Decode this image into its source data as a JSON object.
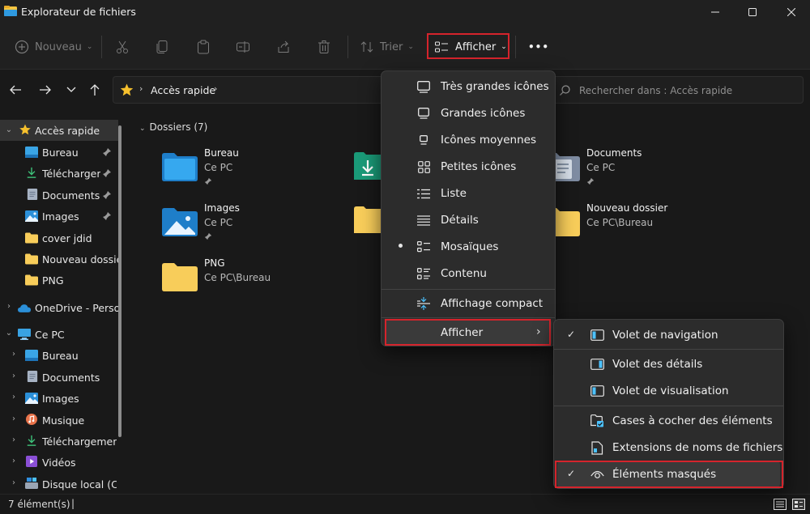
{
  "window": {
    "title": "Explorateur de fichiers"
  },
  "toolbar": {
    "new_label": "Nouveau",
    "sort_label": "Trier",
    "view_label": "Afficher",
    "more_label": "•••"
  },
  "address": {
    "breadcrumb": "Accès rapide",
    "search_placeholder": "Rechercher dans : Accès rapide"
  },
  "sidebar": {
    "quick_access": "Accès rapide",
    "quick_items": [
      {
        "label": "Bureau",
        "pinned": true
      },
      {
        "label": "Téléchargements",
        "pinned": true
      },
      {
        "label": "Documents",
        "pinned": true
      },
      {
        "label": "Images",
        "pinned": true
      },
      {
        "label": "cover jdid",
        "pinned": false
      },
      {
        "label": "Nouveau dossier",
        "pinned": false
      },
      {
        "label": "PNG",
        "pinned": false
      }
    ],
    "onedrive": "OneDrive - Personnel",
    "this_pc": "Ce PC",
    "pc_items": [
      {
        "label": "Bureau"
      },
      {
        "label": "Documents"
      },
      {
        "label": "Images"
      },
      {
        "label": "Musique"
      },
      {
        "label": "Téléchargements"
      },
      {
        "label": "Vidéos"
      },
      {
        "label": "Disque local (C:)"
      }
    ]
  },
  "content": {
    "group_header": "Dossiers (7)",
    "folders": [
      {
        "name": "Bureau",
        "location": "Ce PC",
        "pinned": true
      },
      {
        "name": "Documents",
        "location": "Ce PC",
        "pinned": true
      },
      {
        "name": "Images",
        "location": "Ce PC",
        "pinned": true
      },
      {
        "name": "Nouveau dossier",
        "location": "Ce PC\\Bureau",
        "pinned": false
      },
      {
        "name": "PNG",
        "location": "Ce PC\\Bureau",
        "pinned": false
      }
    ]
  },
  "view_menu": {
    "items": [
      {
        "label": "Très grandes icônes",
        "icon": "monitor-large-icon"
      },
      {
        "label": "Grandes icônes",
        "icon": "monitor-icon"
      },
      {
        "label": "Icônes moyennes",
        "icon": "medium-icons-icon"
      },
      {
        "label": "Petites icônes",
        "icon": "small-icons-grid-icon"
      },
      {
        "label": "Liste",
        "icon": "list-icon"
      },
      {
        "label": "Détails",
        "icon": "details-icon"
      },
      {
        "label": "Mosaïques",
        "icon": "tiles-icon",
        "selected": true
      },
      {
        "label": "Contenu",
        "icon": "content-icon"
      },
      {
        "label": "Affichage compact",
        "icon": "compact-view-icon"
      },
      {
        "label": "Afficher",
        "icon": "chevron-right-icon",
        "has_submenu": true
      }
    ]
  },
  "show_submenu": {
    "items": [
      {
        "label": "Volet de navigation",
        "checked": true
      },
      {
        "label": "Volet des détails",
        "checked": false
      },
      {
        "label": "Volet de visualisation",
        "checked": false
      },
      {
        "label": "Cases à cocher des éléments",
        "checked": false
      },
      {
        "label": "Extensions de noms de fichiers",
        "checked": false
      },
      {
        "label": "Éléments masqués",
        "checked": true
      }
    ]
  },
  "status": {
    "item_count": "7 élément(s)",
    "separator": "|"
  },
  "colors": {
    "accent": "#4cc2ff",
    "highlight_box": "#d5242c",
    "folder_yellow": "#f8cd5a",
    "background": "#191919"
  }
}
